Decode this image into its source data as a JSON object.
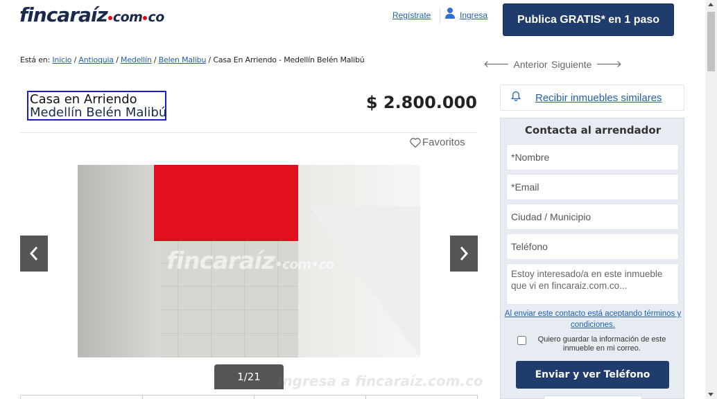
{
  "header": {
    "logo_main": "fincaraíz",
    "logo_domain_1": "com",
    "logo_domain_2": "co",
    "register_label": "Regístrate",
    "login_label": "Ingresa",
    "publish_label": "Publica GRATIS* en 1 paso"
  },
  "breadcrumb": {
    "prefix": "Está en:",
    "items": [
      "Inicio",
      "Antioquia",
      "Medellín",
      "Belen Malibu"
    ],
    "current": "Casa En Arriendo - Medellín Belén Malibú"
  },
  "pager": {
    "prev_label": "Anterior",
    "next_label": "Siguiente"
  },
  "listing": {
    "title_line1": "Casa en Arriendo",
    "title_line2": "Medellín Belén Malibú",
    "price": "$ 2.800.000",
    "favorites_label": "Favoritos",
    "photo_counter": "1/21",
    "watermark_main": "fincaraíz",
    "watermark_domain": "com",
    "watermark_domain_2": "co",
    "bottom_watermark": "Ingresa a fincaraíz.com.co"
  },
  "sidebar": {
    "similar_label": "Recibir inmuebles similares",
    "contact_title": "Contacta al arrendador",
    "fields": {
      "name_placeholder": "*Nombre",
      "email_placeholder": "*Email",
      "city_placeholder": "Ciudad / Municipio",
      "phone_placeholder": "Teléfono",
      "message_placeholder": "Estoy interesado/a en este inmueble que vi en fincaraiz.com.co..."
    },
    "terms_text": "Al enviar este contacto está aceptando términos y condiciones.",
    "save_info_label": "Quiero guardar la información de este inmueble en mi correo.",
    "send_button_label": "Enviar y ver Teléfono"
  },
  "colors": {
    "brand_navy": "#1f3c6c",
    "link_blue": "#2060b0",
    "accent_red": "#e30613"
  },
  "icons": [
    "user-icon",
    "arrow-left-icon",
    "arrow-right-icon",
    "heart-icon",
    "bell-icon",
    "chevron-left-icon",
    "chevron-right-icon"
  ]
}
